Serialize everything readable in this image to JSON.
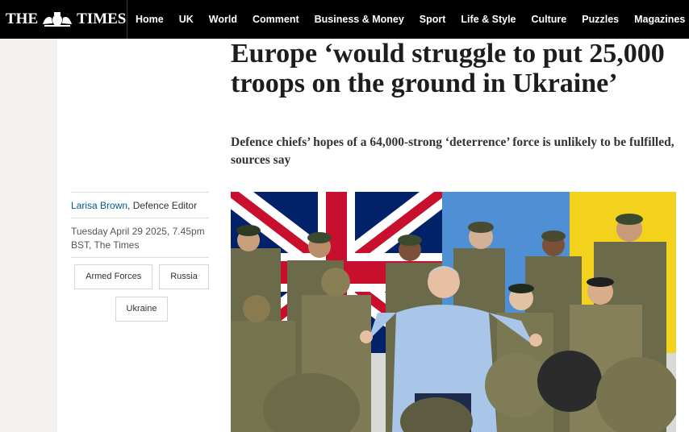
{
  "header": {
    "logo_left": "THE",
    "logo_right": "TIMES",
    "nav": [
      "Home",
      "UK",
      "World",
      "Comment",
      "Business & Money",
      "Sport",
      "Life & Style",
      "Culture",
      "Puzzles",
      "Magazines"
    ]
  },
  "article": {
    "headline": "Europe ‘would struggle to put 25,000 troops on the ground in Ukraine’",
    "standfirst": "Defence chiefs’ hopes of a 64,000-strong ‘deterrence’ force is unlikely to be fulfilled, sources say",
    "author": "Larisa Brown",
    "author_role": ", Defence Editor",
    "dateline": "Tuesday April 29 2025, 7.45pm BST, The Times",
    "tags": [
      "Armed Forces",
      "Russia",
      "Ukraine"
    ]
  },
  "colors": {
    "nav_bg": "#000000",
    "link_blue": "#005b8e",
    "flag_red": "#c8102e",
    "flag_blue": "#012169",
    "ukraine_blue": "#4f8fd4",
    "ukraine_yellow": "#f2d21c",
    "camo": "#6b6a4a"
  }
}
